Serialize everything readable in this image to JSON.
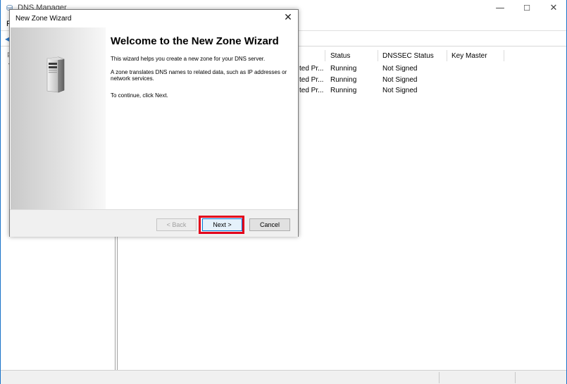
{
  "main_window": {
    "title": "DNS Manager",
    "menu_first": "F",
    "caption": {
      "minimize": "—",
      "maximize": "☐",
      "close": "✕"
    }
  },
  "list": {
    "columns": [
      "Status",
      "DNSSEC Status",
      "Key Master"
    ],
    "rows": [
      {
        "partial": "ted Pr...",
        "status": "Running",
        "dnssec": "Not Signed",
        "keymaster": ""
      },
      {
        "partial": "ted Pr...",
        "status": "Running",
        "dnssec": "Not Signed",
        "keymaster": ""
      },
      {
        "partial": "ted Pr...",
        "status": "Running",
        "dnssec": "Not Signed",
        "keymaster": ""
      }
    ]
  },
  "wizard": {
    "title": "New Zone Wizard",
    "close": "✕",
    "heading": "Welcome to the New Zone Wizard",
    "para1": "This wizard helps you create a new zone for your DNS server.",
    "para2": "A zone translates DNS names to related data, such as IP addresses or network services.",
    "para3": "To continue, click Next.",
    "buttons": {
      "back": "< Back",
      "next": "Next >",
      "cancel": "Cancel"
    },
    "highlight_color": "#e3001b"
  }
}
